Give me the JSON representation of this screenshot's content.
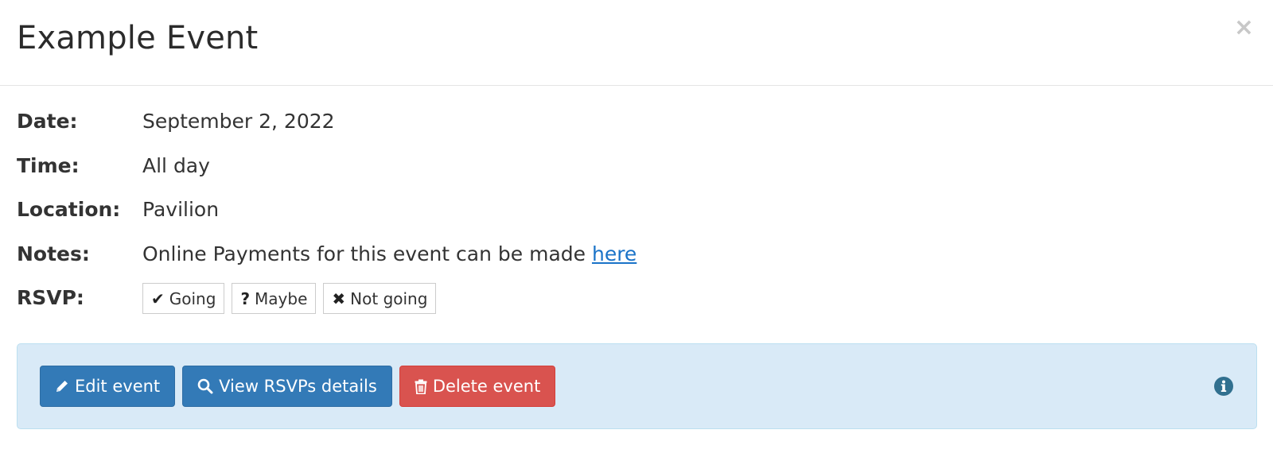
{
  "modal": {
    "title": "Example Event",
    "close_symbol": "×"
  },
  "details": {
    "date": {
      "label": "Date:",
      "value": "September 2, 2022"
    },
    "time": {
      "label": "Time:",
      "value": "All day"
    },
    "location": {
      "label": "Location:",
      "value": "Pavilion"
    },
    "notes": {
      "label": "Notes:",
      "value_prefix": "Online Payments for this event can be made ",
      "link_text": "here"
    },
    "rsvp": {
      "label": "RSVP:",
      "options": [
        {
          "icon": "check-icon",
          "glyph": "✔",
          "label": "Going"
        },
        {
          "icon": "question-icon",
          "glyph": "?",
          "label": "Maybe"
        },
        {
          "icon": "x-icon",
          "glyph": "✖",
          "label": "Not going"
        }
      ]
    }
  },
  "actions": {
    "edit_label": "Edit event",
    "edit_icon": "pencil-icon",
    "view_rsvps_label": "View RSVPs details",
    "view_rsvps_icon": "search-icon",
    "delete_label": "Delete event",
    "delete_icon": "trash-icon",
    "info_icon": "info-icon"
  },
  "colors": {
    "primary": "#337ab7",
    "danger": "#d9534f",
    "well_background": "#d9eaf7",
    "link": "#1a73c8",
    "info": "#31708f"
  }
}
